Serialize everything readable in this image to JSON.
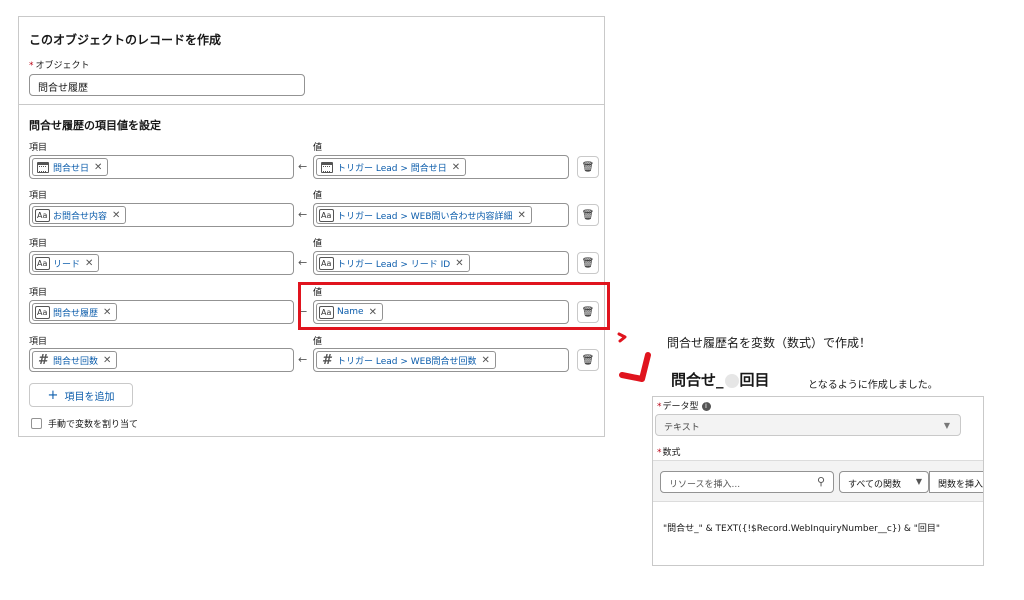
{
  "record_panel": {
    "title": "このオブジェクトのレコードを作成",
    "object_label": "オブジェクト",
    "object_value": "問合せ履歴",
    "section_title": "問合せ履歴の項目値を設定",
    "field_header": "項目",
    "value_header": "値",
    "rows": [
      {
        "field_icon": "calendar-icon",
        "field": "問合せ日",
        "value_icon": "calendar-icon",
        "value": "トリガー Lead > 問合せ日"
      },
      {
        "field_icon": "text-icon",
        "field": "お問合せ内容",
        "value_icon": "text-icon",
        "value": "トリガー Lead > WEB問い合わせ内容詳細"
      },
      {
        "field_icon": "text-icon",
        "field": "リード",
        "value_icon": "text-icon",
        "value": "トリガー Lead > リード ID"
      },
      {
        "field_icon": "text-icon",
        "field": "問合せ履歴",
        "value_icon": "text-icon",
        "value": "Name"
      },
      {
        "field_icon": "number-icon",
        "field": "問合せ回数",
        "value_icon": "number-icon",
        "value": "トリガー Lead > WEB問合せ回数"
      }
    ],
    "add_button": "項目を追加",
    "manual_checkbox": "手動で変数を割り当て"
  },
  "annotation": {
    "line1": "問合せ履歴名を変数（数式）で作成！",
    "line2_prefix": "問合せ_",
    "line2_suffix": "回目",
    "line3": "となるように作成しました。",
    "highlight_color": "#e0141e"
  },
  "formula_panel": {
    "data_type_label": "データ型",
    "data_type_value": "テキスト",
    "formula_label": "数式",
    "resource_placeholder": "リソースを挿入...",
    "functions_select": "すべての関数",
    "insert_function": "関数を挿入",
    "formula_text": "\"問合せ_\" & TEXT({!$Record.WebInquiryNumber__c}) & \"回目\""
  }
}
